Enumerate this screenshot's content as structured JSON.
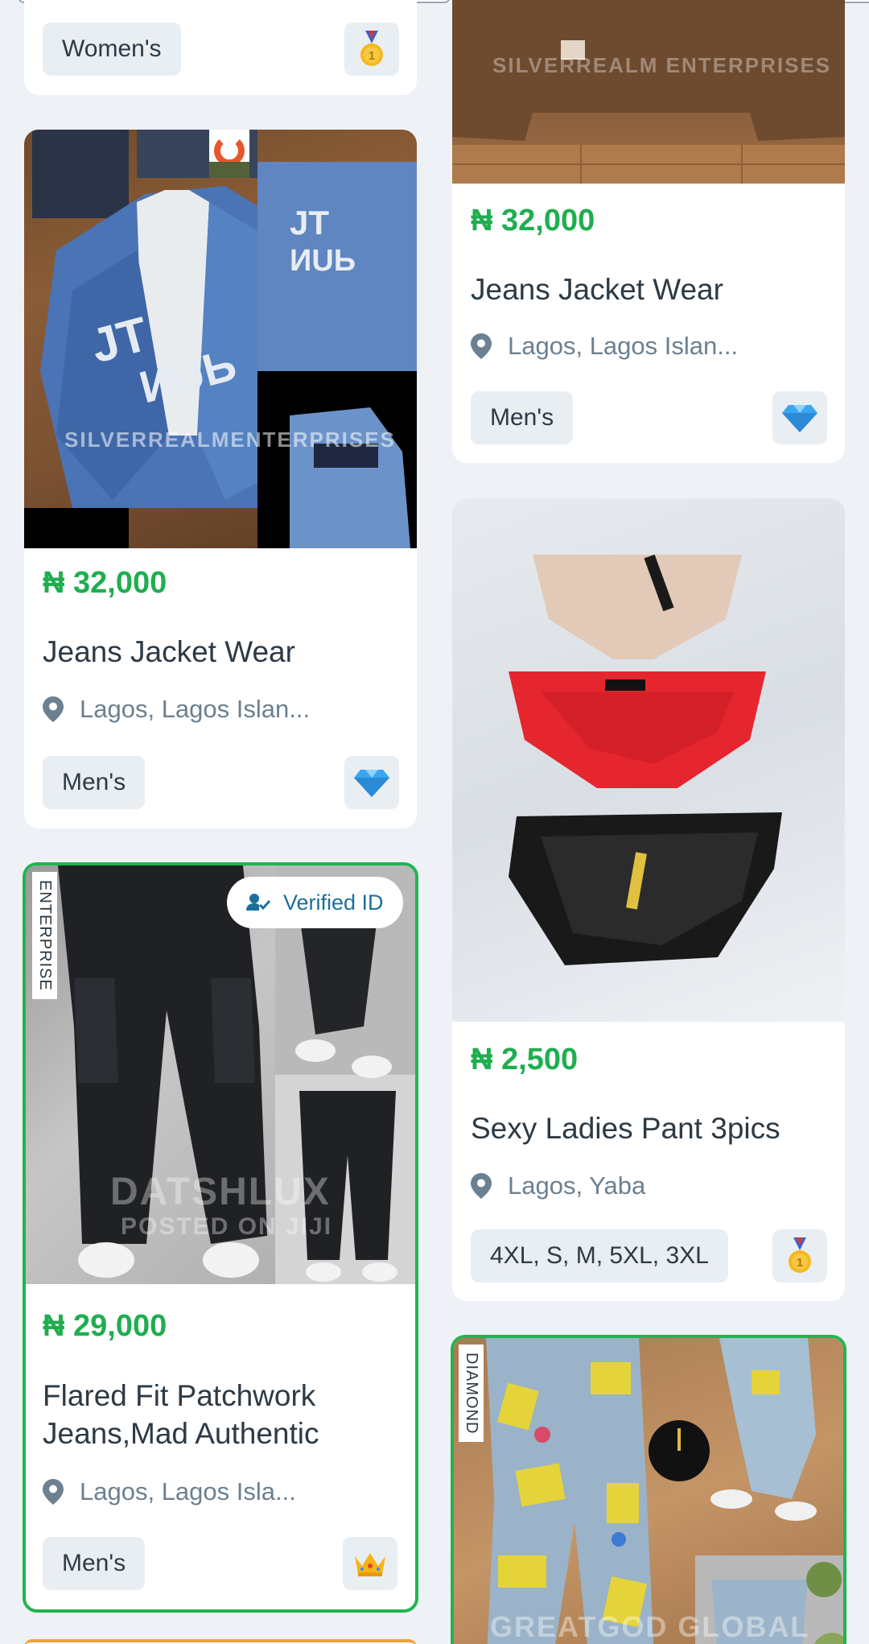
{
  "colors": {
    "price": "#1fae4f",
    "border_highlight": "#21b450",
    "location": "#6b8091",
    "text": "#2d3a45"
  },
  "listings": [
    {
      "tag": "Women's",
      "badge": "gold-medal-icon"
    },
    {
      "price": "₦ 32,000",
      "title": "Jeans Jacket Wear",
      "location": "Lagos, Lagos Islan...",
      "tag": "Men's",
      "badge": "diamond-icon",
      "watermark": "SILVERREALMENTERPRISES"
    },
    {
      "price": "₦ 32,000",
      "title": "Jeans Jacket Wear",
      "location": "Lagos, Lagos Islan...",
      "tag": "Men's",
      "badge": "diamond-icon",
      "watermark": "SILVERREALM ENTERPRISES"
    },
    {
      "price": "₦ 29,000",
      "title_line1": "Flared Fit Patchwork",
      "title_line2": "Jeans,Mad Authentic",
      "location": "Lagos, Lagos Isla...",
      "tag": "Men's",
      "badge": "crown-icon",
      "ribbon": "ENTERPRISE",
      "verified": "Verified ID",
      "watermark": "DATSHLUX",
      "watermark2": "POSTED ON JIJI"
    },
    {
      "price": "₦ 2,500",
      "title": "Sexy Ladies Pant 3pics",
      "location": "Lagos, Yaba",
      "tag": "4XL, S, M, 5XL, 3XL",
      "badge": "gold-medal-icon"
    },
    {
      "ribbon": "DIAMOND",
      "watermark": "GREATGOD GLOBAL"
    }
  ]
}
